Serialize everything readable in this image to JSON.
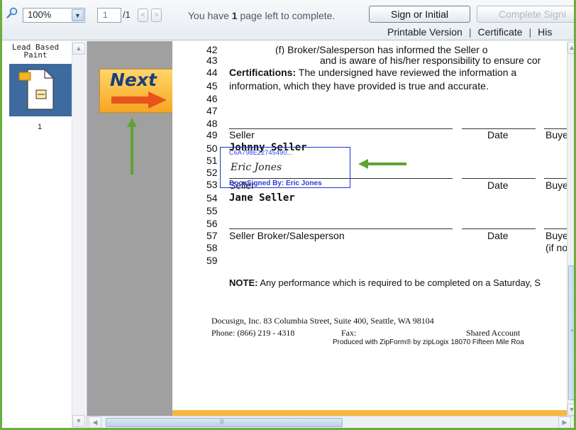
{
  "toolbar": {
    "zoom_value": "100%",
    "page_current": "1",
    "page_total": "/1",
    "prev_arrow": "<",
    "next_arrow": ">",
    "status_prefix": "You have ",
    "status_count": "1",
    "status_suffix": " page left to complete.",
    "sign_button": "Sign or Initial",
    "complete_button": "Complete Signi",
    "links": [
      "Printable Version",
      "Certificate",
      "His"
    ]
  },
  "thumbnails": {
    "title": "Lead Based Paint",
    "page_number": "1"
  },
  "next_button": {
    "label": "Next"
  },
  "document": {
    "lines": [
      {
        "n": "42",
        "text": "(f)        Broker/Salesperson has informed the Seller o"
      },
      {
        "n": "43",
        "text": "and is aware of his/her responsibility to ensure cor"
      },
      {
        "n": "44",
        "bold": "Certifications:",
        "text": " The undersigned have reviewed the information a"
      },
      {
        "n": "45",
        "text": "information, which they have provided is true and accurate."
      },
      {
        "n": "46"
      },
      {
        "n": "47"
      },
      {
        "n": "48"
      },
      {
        "n": "49",
        "text": "Seller"
      },
      {
        "n": "50",
        "mono": "Johnny Seller"
      },
      {
        "n": "51"
      },
      {
        "n": "52"
      },
      {
        "n": "53",
        "text": "Seller"
      },
      {
        "n": "54",
        "mono": "Jane Seller"
      },
      {
        "n": "55"
      },
      {
        "n": "56"
      },
      {
        "n": "57",
        "text": "Seller Broker/Salesperson"
      },
      {
        "n": "58"
      },
      {
        "n": "59"
      }
    ],
    "date_label": "Date",
    "buyer_label": "Buye",
    "if_label": "(if no",
    "signature": {
      "id": "C6A798E22745490...",
      "script": "Eric Jones",
      "signed_by": "DocuSigned By: Eric Jones"
    },
    "note_label": "NOTE:",
    "note_text": "  Any performance which is required to be completed on a Saturday, S",
    "footer_line1": "Docusign, Inc. 83 Columbia Street, Suite 400, Seattle, WA  98104",
    "footer_phone": "Phone: (866) 219 - 4318",
    "footer_fax": "Fax:",
    "footer_shared": "Shared  Account",
    "footer_produced": "Produced with ZipForm® by zipLogix 18070 Fifteen Mile Roa"
  },
  "colors": {
    "frame_border": "#6cad3e",
    "next_button_bg": "#f6a623",
    "arrow_green": "#5ea332",
    "signature_blue": "#2233cc",
    "thumb_selected": "#3d6a9f"
  },
  "icons": [
    "magnifier-icon",
    "chevron-down-icon",
    "document-thumbnail-icon",
    "right-arrow-icon",
    "up-arrow-icon",
    "left-arrow-icon"
  ]
}
